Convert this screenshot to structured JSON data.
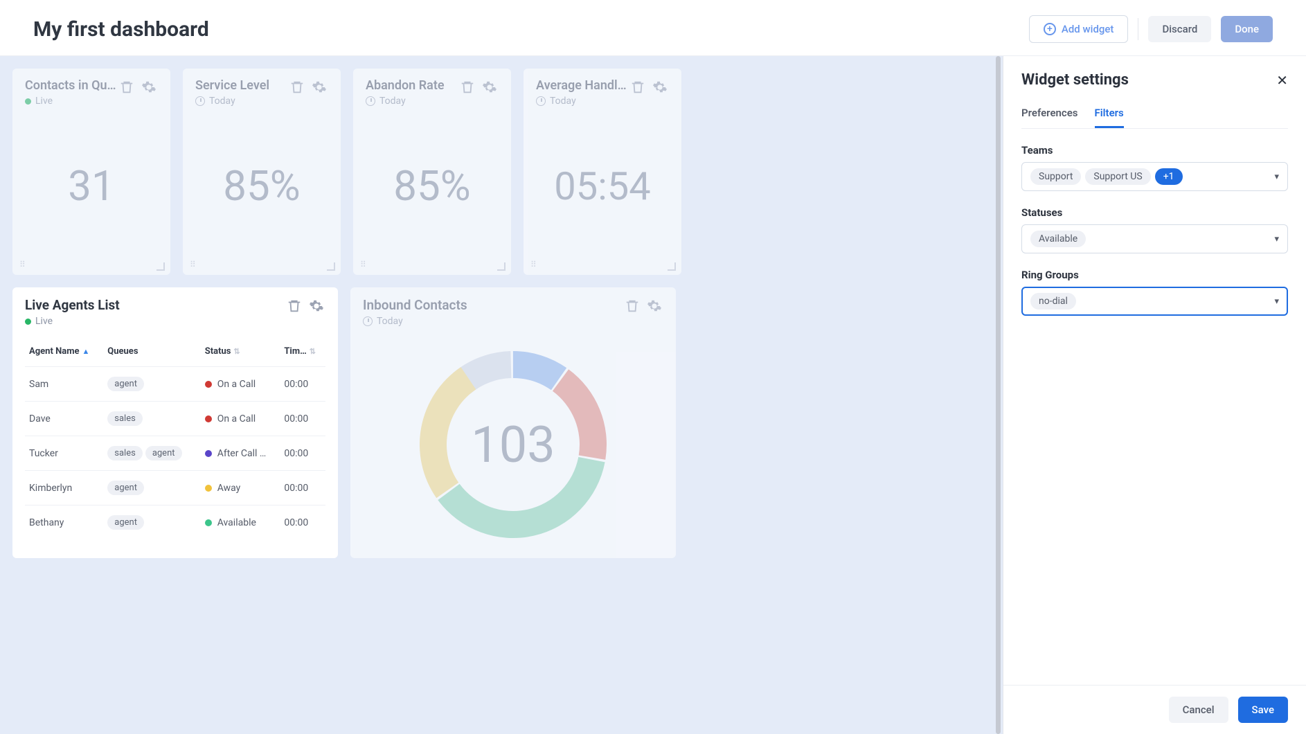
{
  "header": {
    "title": "My first dashboard",
    "add_widget": "Add widget",
    "discard": "Discard",
    "done": "Done"
  },
  "widgets": {
    "contacts_queue": {
      "title": "Contacts in Qu…",
      "sub": "Live",
      "value": "31"
    },
    "service_level": {
      "title": "Service Level",
      "sub": "Today",
      "value": "85%"
    },
    "abandon_rate": {
      "title": "Abandon Rate",
      "sub": "Today",
      "value": "85%"
    },
    "avg_handle": {
      "title": "Average Handl…",
      "sub": "Today",
      "value": "05:54"
    },
    "live_agents": {
      "title": "Live Agents List",
      "sub": "Live"
    },
    "inbound": {
      "title": "Inbound Contacts",
      "sub": "Today",
      "value": "103"
    }
  },
  "agents_table": {
    "cols": {
      "name": "Agent Name",
      "queues": "Queues",
      "status": "Status",
      "time": "Tim…"
    },
    "rows": [
      {
        "name": "Sam",
        "queues": [
          "agent"
        ],
        "status": "On a Call",
        "dot": "red",
        "time": "00:00"
      },
      {
        "name": "Dave",
        "queues": [
          "sales"
        ],
        "status": "On a Call",
        "dot": "red",
        "time": "00:00"
      },
      {
        "name": "Tucker",
        "queues": [
          "sales",
          "agent"
        ],
        "status": "After Call …",
        "dot": "purple",
        "time": "00:00"
      },
      {
        "name": "Kimberlyn",
        "queues": [
          "agent"
        ],
        "status": "Away",
        "dot": "yellow",
        "time": "00:00"
      },
      {
        "name": "Bethany",
        "queues": [
          "agent"
        ],
        "status": "Available",
        "dot": "green",
        "time": "00:00"
      }
    ]
  },
  "settings": {
    "title": "Widget settings",
    "tabs": {
      "preferences": "Preferences",
      "filters": "Filters"
    },
    "teams_label": "Teams",
    "teams": [
      "Support",
      "Support US"
    ],
    "teams_more": "+1",
    "statuses_label": "Statuses",
    "statuses": [
      "Available"
    ],
    "ring_label": "Ring Groups",
    "ring": [
      "no-dial"
    ],
    "cancel": "Cancel",
    "save": "Save"
  },
  "chart_data": {
    "type": "pie",
    "title": "Inbound Contacts",
    "total": 103,
    "series": [
      {
        "name": "segment-green",
        "value": 38,
        "color": "#8fd6b7"
      },
      {
        "name": "segment-yellow",
        "value": 26,
        "color": "#f1d98a"
      },
      {
        "name": "segment-grey",
        "value": 11,
        "color": "#d5dbe6"
      },
      {
        "name": "segment-blue",
        "value": 10,
        "color": "#93b8ec"
      },
      {
        "name": "segment-red",
        "value": 18,
        "color": "#e3938b"
      }
    ]
  }
}
